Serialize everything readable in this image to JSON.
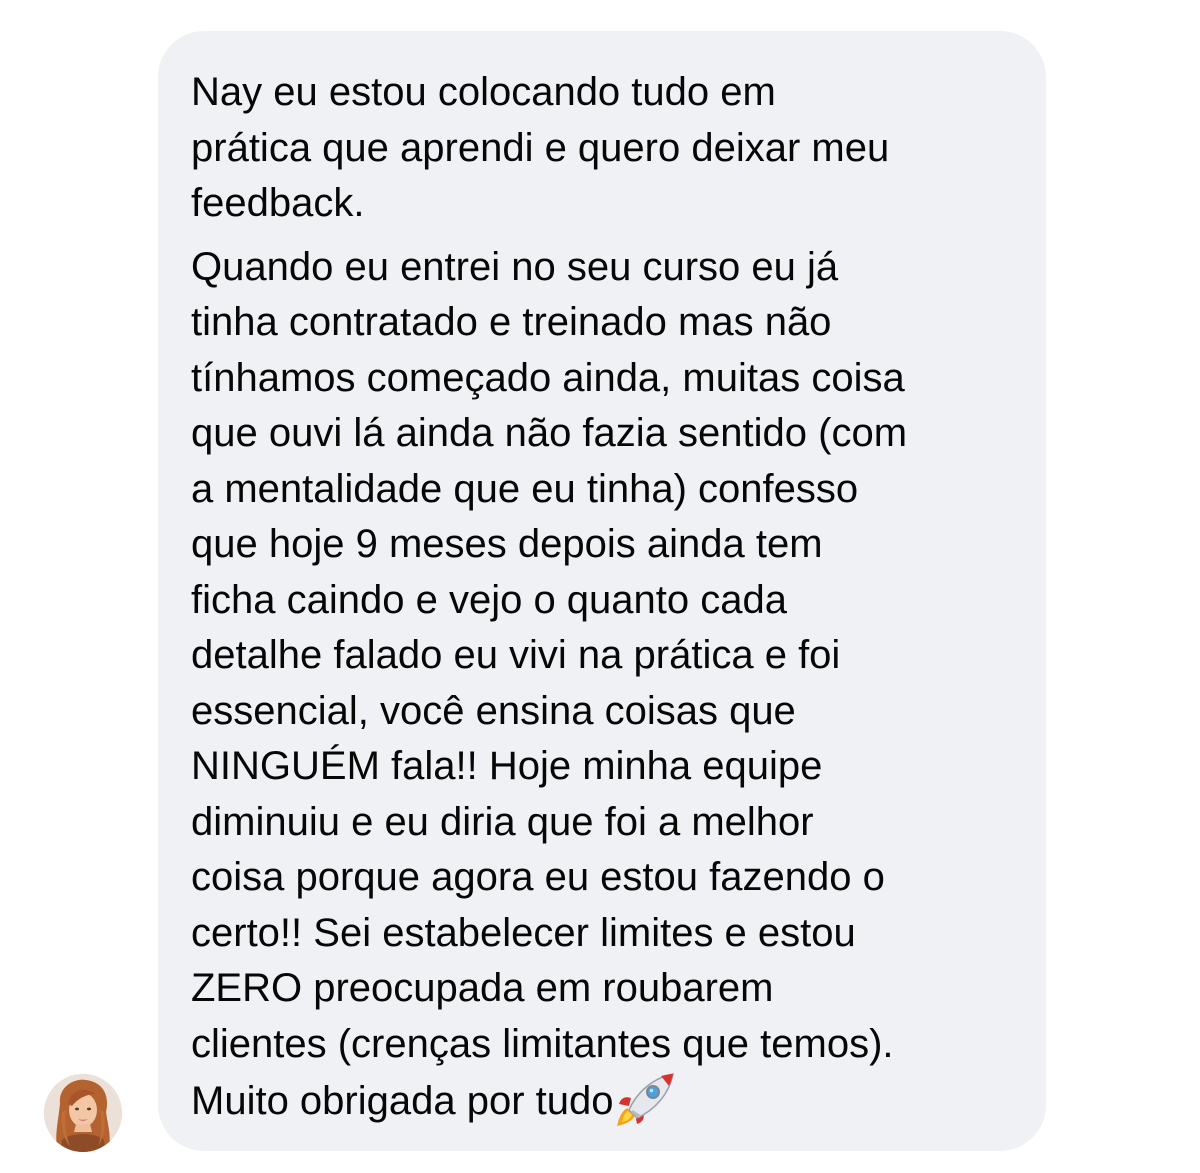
{
  "message": {
    "paragraphs": [
      {
        "lines": [
          "Nay eu estou colocando tudo em",
          "prática que aprendi e quero deixar meu",
          "feedback."
        ]
      },
      {
        "lines": [
          "Quando eu entrei no seu curso eu já",
          "tinha contratado e treinado mas não",
          "tínhamos começado ainda, muitas coisa",
          "que ouvi lá ainda não fazia sentido (com",
          "a mentalidade que eu tinha) confesso",
          "que hoje 9 meses depois ainda tem",
          "ficha caindo e vejo o quanto cada",
          "detalhe falado eu vivi na prática e foi",
          "essencial, você ensina coisas que",
          "NINGUÉM fala!! Hoje minha equipe",
          "diminuiu e eu diria que foi a melhor",
          "coisa porque agora eu estou fazendo o",
          "certo!! Sei estabelecer limites e estou",
          "ZERO preocupada em roubarem",
          "clientes (crenças limitantes que temos).",
          "Muito obrigada por tudo"
        ]
      }
    ],
    "trailing_emoji": "rocket-emoji"
  },
  "sender": {
    "avatar": "profile-photo"
  },
  "colors": {
    "bubble_background": "#eff1f5",
    "text": "#070707",
    "page_background": "#ffffff"
  }
}
